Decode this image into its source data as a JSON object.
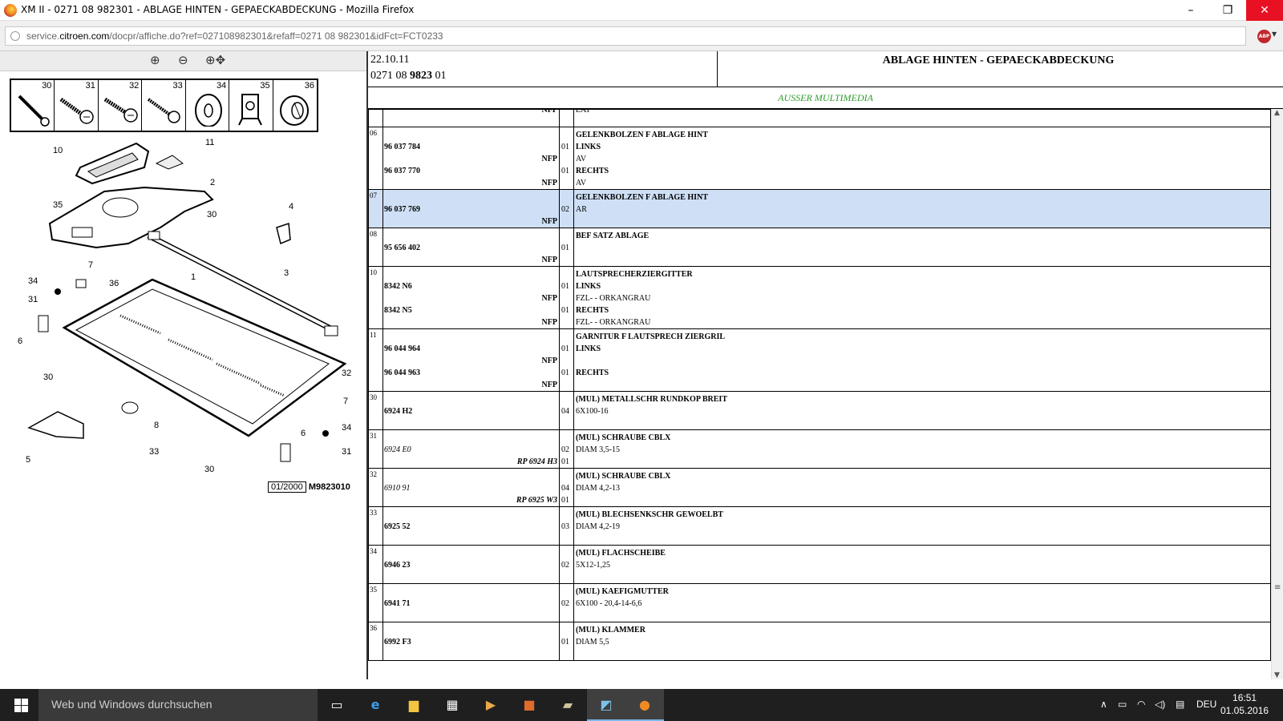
{
  "window": {
    "title": "XM II - 0271 08 982301 - ABLAGE HINTEN - GEPAECKABDECKUNG - Mozilla Firefox",
    "min_glyph": "–",
    "max_glyph": "❐",
    "close_glyph": "✕"
  },
  "urlbar": {
    "url_prefix": "service.",
    "url_host": "citroen.com",
    "url_path": "/docpr/affiche.do?ref=027108982301&refaff=0271 08 982301&idFct=FCT0233",
    "abp_label": "ABP"
  },
  "zoom": {
    "in_glyph": "⊕",
    "out_glyph": "⊖",
    "fit_glyph": "⊕✥"
  },
  "parts_strip": [
    "30",
    "31",
    "32",
    "33",
    "34",
    "35",
    "36"
  ],
  "diagram": {
    "caption_date": "01/2000",
    "caption_code": "M9823010",
    "callouts": [
      "10",
      "11",
      "2",
      "35",
      "30",
      "4",
      "7",
      "36",
      "1",
      "3",
      "34",
      "31",
      "6",
      "30",
      "32",
      "7",
      "8",
      "34",
      "5",
      "33",
      "6",
      "30",
      "31"
    ]
  },
  "header": {
    "date": "22.10.11",
    "ref_prefix": "0271 08 ",
    "ref_bold": "9823",
    "ref_suffix": " 01",
    "title": "ABLAGE HINTEN - GEPAECKABDECKUNG",
    "subtitle": "AUSSER MULTIMEDIA"
  },
  "table": {
    "rows": [
      {
        "pos": "",
        "selected": false,
        "ref": [
          {
            "t": "NFP",
            "s": "nfp"
          }
        ],
        "qty": [
          ""
        ],
        "desc": [
          {
            "t": "EAT",
            "s": ""
          }
        ],
        "partial": true
      },
      {
        "pos": "06",
        "selected": false,
        "ref": [
          {
            "t": "",
            "s": ""
          },
          {
            "t": "96 037 784",
            "s": "pn"
          },
          {
            "t": "NFP",
            "s": "nfp"
          },
          {
            "t": "96 037 770",
            "s": "pn"
          },
          {
            "t": "NFP",
            "s": "nfp"
          }
        ],
        "qty": [
          "",
          "01",
          "",
          "01",
          ""
        ],
        "desc": [
          {
            "t": "GELENKBOLZEN F ABLAGE HINT",
            "s": "b"
          },
          {
            "t": "LINKS",
            "s": "b"
          },
          {
            "t": "AV",
            "s": ""
          },
          {
            "t": "RECHTS",
            "s": "b"
          },
          {
            "t": "AV",
            "s": ""
          }
        ]
      },
      {
        "pos": "07",
        "selected": true,
        "ref": [
          {
            "t": "",
            "s": ""
          },
          {
            "t": "96 037 769",
            "s": "pn"
          },
          {
            "t": "NFP",
            "s": "nfp"
          }
        ],
        "qty": [
          "",
          "02",
          ""
        ],
        "desc": [
          {
            "t": "GELENKBOLZEN F ABLAGE HINT",
            "s": "b"
          },
          {
            "t": "AR",
            "s": ""
          },
          {
            "t": "",
            "s": ""
          }
        ]
      },
      {
        "pos": "08",
        "selected": false,
        "ref": [
          {
            "t": "",
            "s": ""
          },
          {
            "t": "95 656 402",
            "s": "pn"
          },
          {
            "t": "NFP",
            "s": "nfp"
          }
        ],
        "qty": [
          "",
          "01",
          ""
        ],
        "desc": [
          {
            "t": "BEF SATZ ABLAGE",
            "s": "b"
          },
          {
            "t": "",
            "s": ""
          },
          {
            "t": "",
            "s": ""
          }
        ]
      },
      {
        "pos": "10",
        "selected": false,
        "ref": [
          {
            "t": "",
            "s": ""
          },
          {
            "t": "8342 N6",
            "s": "pn"
          },
          {
            "t": "NFP",
            "s": "nfp"
          },
          {
            "t": "8342 N5",
            "s": "pn"
          },
          {
            "t": "NFP",
            "s": "nfp"
          }
        ],
        "qty": [
          "",
          "01",
          "",
          "01",
          ""
        ],
        "desc": [
          {
            "t": "LAUTSPRECHERZIERGITTER",
            "s": "b"
          },
          {
            "t": "LINKS",
            "s": "b"
          },
          {
            "t": "FZL- - ORKANGRAU",
            "s": ""
          },
          {
            "t": "RECHTS",
            "s": "b"
          },
          {
            "t": "FZL- - ORKANGRAU",
            "s": ""
          }
        ]
      },
      {
        "pos": "11",
        "selected": false,
        "ref": [
          {
            "t": "",
            "s": ""
          },
          {
            "t": "96 044 964",
            "s": "pn"
          },
          {
            "t": "NFP",
            "s": "nfp"
          },
          {
            "t": "96 044 963",
            "s": "pn"
          },
          {
            "t": "NFP",
            "s": "nfp"
          }
        ],
        "qty": [
          "",
          "01",
          "",
          "01",
          ""
        ],
        "desc": [
          {
            "t": "GARNITUR F LAUTSPRECH ZIERGRIL",
            "s": "b"
          },
          {
            "t": "LINKS",
            "s": "b"
          },
          {
            "t": "",
            "s": ""
          },
          {
            "t": "RECHTS",
            "s": "b"
          },
          {
            "t": "",
            "s": ""
          }
        ]
      },
      {
        "pos": "30",
        "selected": false,
        "ref": [
          {
            "t": "",
            "s": ""
          },
          {
            "t": "6924 H2",
            "s": "pn"
          },
          {
            "t": "",
            "s": ""
          }
        ],
        "qty": [
          "",
          "04",
          ""
        ],
        "desc": [
          {
            "t": "(MUL) METALLSCHR RUNDKOP BREIT",
            "s": "b"
          },
          {
            "t": "6X100-16",
            "s": ""
          },
          {
            "t": "",
            "s": ""
          }
        ]
      },
      {
        "pos": "31",
        "selected": false,
        "ref": [
          {
            "t": "",
            "s": ""
          },
          {
            "t": "6924 E0",
            "s": "pn-it"
          },
          {
            "t": "RP 6924 H3",
            "s": "rp"
          }
        ],
        "qty": [
          "",
          "02",
          "01"
        ],
        "desc": [
          {
            "t": "(MUL) SCHRAUBE CBLX",
            "s": "b"
          },
          {
            "t": "DIAM 3,5-15",
            "s": ""
          },
          {
            "t": "",
            "s": ""
          }
        ]
      },
      {
        "pos": "32",
        "selected": false,
        "ref": [
          {
            "t": "",
            "s": ""
          },
          {
            "t": "6910 91",
            "s": "pn-it"
          },
          {
            "t": "RP 6925 W3",
            "s": "rp"
          }
        ],
        "qty": [
          "",
          "04",
          "01"
        ],
        "desc": [
          {
            "t": "(MUL) SCHRAUBE CBLX",
            "s": "b"
          },
          {
            "t": "DIAM 4,2-13",
            "s": ""
          },
          {
            "t": "",
            "s": ""
          }
        ]
      },
      {
        "pos": "33",
        "selected": false,
        "ref": [
          {
            "t": "",
            "s": ""
          },
          {
            "t": "6925 52",
            "s": "pn"
          },
          {
            "t": "",
            "s": ""
          }
        ],
        "qty": [
          "",
          "03",
          ""
        ],
        "desc": [
          {
            "t": "(MUL) BLECHSENKSCHR GEWOELBT",
            "s": "b"
          },
          {
            "t": "DIAM 4,2-19",
            "s": ""
          },
          {
            "t": "",
            "s": ""
          }
        ]
      },
      {
        "pos": "34",
        "selected": false,
        "ref": [
          {
            "t": "",
            "s": ""
          },
          {
            "t": "6946 23",
            "s": "pn"
          },
          {
            "t": "",
            "s": ""
          }
        ],
        "qty": [
          "",
          "02",
          ""
        ],
        "desc": [
          {
            "t": "(MUL) FLACHSCHEIBE",
            "s": "b"
          },
          {
            "t": "5X12-1,25",
            "s": ""
          },
          {
            "t": "",
            "s": ""
          }
        ]
      },
      {
        "pos": "35",
        "selected": false,
        "ref": [
          {
            "t": "",
            "s": ""
          },
          {
            "t": "6941 71",
            "s": "pn"
          },
          {
            "t": "",
            "s": ""
          }
        ],
        "qty": [
          "",
          "02",
          ""
        ],
        "desc": [
          {
            "t": "(MUL) KAEFIGMUTTER",
            "s": "b"
          },
          {
            "t": "6X100 - 20,4-14-6,6",
            "s": ""
          },
          {
            "t": "",
            "s": ""
          }
        ]
      },
      {
        "pos": "36",
        "selected": false,
        "ref": [
          {
            "t": "",
            "s": ""
          },
          {
            "t": "6992 F3",
            "s": "pn"
          },
          {
            "t": "",
            "s": ""
          }
        ],
        "qty": [
          "",
          "01",
          ""
        ],
        "desc": [
          {
            "t": "(MUL) KLAMMER",
            "s": "b"
          },
          {
            "t": "DIAM 5,5",
            "s": ""
          },
          {
            "t": "",
            "s": ""
          }
        ]
      }
    ]
  },
  "taskbar": {
    "search_placeholder": "Web und Windows durchsuchen",
    "language": "DEU",
    "time": "16:51",
    "date": "01.05.2016",
    "icons": [
      "task-view-icon",
      "edge-icon",
      "file-explorer-icon",
      "store-icon",
      "media-icon",
      "office-icon",
      "remote-icon",
      "app-icon",
      "firefox-icon"
    ]
  },
  "colors": {
    "selected_row": "#cfe0f6",
    "subtitle": "#2e9b2e",
    "taskbar": "#1f1f1f"
  }
}
